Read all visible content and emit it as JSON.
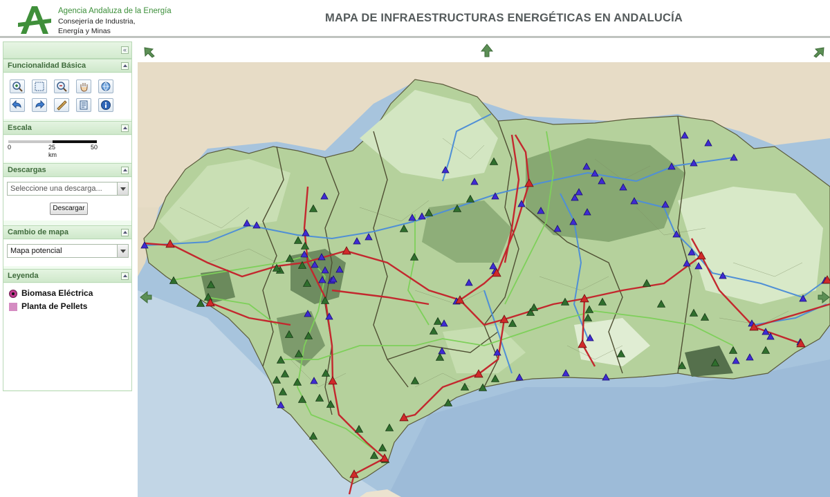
{
  "header": {
    "org_name": "Agencia Andaluza de la Energía",
    "dept_line_1": "Consejería de Industria,",
    "dept_line_2": "Energía y Minas",
    "title": "MAPA DE INFRAESTRUCTURAS ENERGÉTICAS EN ANDALUCÍA"
  },
  "sidebar": {
    "collapse_icon": "double-chevron-left-icon",
    "panels": {
      "basic": {
        "title": "Funcionalidad Básica",
        "tools": [
          "zoom-in-icon",
          "zoom-box-icon",
          "zoom-out-icon",
          "pan-hand-icon",
          "full-extent-icon",
          "back-icon",
          "forward-icon",
          "measure-icon",
          "layers-icon",
          "info-icon"
        ]
      },
      "scale": {
        "title": "Escala",
        "ticks": [
          "0",
          "25",
          "50"
        ],
        "unit": "km"
      },
      "downloads": {
        "title": "Descargas",
        "select_value": "Seleccione una descarga...",
        "button_label": "Descargar"
      },
      "map_change": {
        "title": "Cambio de mapa",
        "select_value": "Mapa potencial"
      },
      "legend": {
        "title": "Leyenda",
        "items": [
          "Biomasa Eléctrica",
          "Planta de Pellets"
        ]
      }
    }
  },
  "map": {
    "pan_icons": [
      "pan-northwest-icon",
      "pan-north-icon",
      "pan-northeast-icon",
      "pan-west-icon",
      "pan-east-icon"
    ],
    "colors": {
      "sea": "#a7c4dd",
      "land_outside": "#e7dcc6",
      "region_light": "#d7e9c7",
      "region_mid": "#a9c98f",
      "region_dark": "#6f8f62",
      "road": "#c3282e",
      "pipeline_blue": "#4f8fd6",
      "line_green": "#7ed05a",
      "marker_blue": "#3f2bd3",
      "marker_green": "#2f6e2d",
      "marker_red": "#d02a2a"
    },
    "markers": {
      "blue": [
        [
          209,
          355
        ],
        [
          469,
          284
        ],
        [
          357,
          323
        ],
        [
          371,
          326
        ],
        [
          516,
          349
        ],
        [
          533,
          343
        ],
        [
          596,
          315
        ],
        [
          610,
          313
        ],
        [
          644,
          246
        ],
        [
          686,
          263
        ],
        [
          716,
          284
        ],
        [
          716,
          392
        ],
        [
          713,
          385
        ],
        [
          678,
          409
        ],
        [
          660,
          436
        ],
        [
          642,
          468
        ],
        [
          848,
          241
        ],
        [
          860,
          251
        ],
        [
          870,
          262
        ],
        [
          901,
          271
        ],
        [
          837,
          278
        ],
        [
          831,
          286
        ],
        [
          849,
          307
        ],
        [
          829,
          321
        ],
        [
          806,
          331
        ],
        [
          754,
          295
        ],
        [
          782,
          305
        ],
        [
          917,
          291
        ],
        [
          962,
          296
        ],
        [
          978,
          339
        ],
        [
          1000,
          365
        ],
        [
          1010,
          385
        ],
        [
          993,
          381
        ],
        [
          1045,
          399
        ],
        [
          1087,
          468
        ],
        [
          1107,
          480
        ],
        [
          1114,
          487
        ],
        [
          1084,
          517
        ],
        [
          1064,
          522
        ],
        [
          1157,
          495
        ],
        [
          1161,
          432
        ],
        [
          1193,
          406
        ],
        [
          990,
          196
        ],
        [
          1024,
          207
        ],
        [
          1003,
          236
        ],
        [
          971,
          241
        ],
        [
          1061,
          228
        ],
        [
          853,
          489
        ],
        [
          818,
          540
        ],
        [
          876,
          546
        ],
        [
          751,
          546
        ],
        [
          719,
          510
        ],
        [
          639,
          508
        ],
        [
          491,
          390
        ],
        [
          479,
          406
        ],
        [
          476,
          458
        ],
        [
          445,
          454
        ],
        [
          454,
          551
        ],
        [
          406,
          586
        ],
        [
          470,
          391
        ],
        [
          465,
          372
        ],
        [
          440,
          368
        ],
        [
          442,
          337
        ],
        [
          455,
          383
        ],
        [
          482,
          404
        ],
        [
          466,
          405
        ]
      ],
      "green": [
        [
          714,
          234
        ],
        [
          661,
          302
        ],
        [
          680,
          288
        ],
        [
          620,
          308
        ],
        [
          584,
          331
        ],
        [
          599,
          372
        ],
        [
          453,
          302
        ],
        [
          419,
          374
        ],
        [
          405,
          391
        ],
        [
          437,
          384
        ],
        [
          441,
          356
        ],
        [
          431,
          348
        ],
        [
          444,
          410
        ],
        [
          470,
          435
        ],
        [
          418,
          484
        ],
        [
          446,
          486
        ],
        [
          432,
          512
        ],
        [
          406,
          521
        ],
        [
          412,
          541
        ],
        [
          400,
          550
        ],
        [
          409,
          567
        ],
        [
          430,
          553
        ],
        [
          437,
          578
        ],
        [
          462,
          576
        ],
        [
          478,
          585
        ],
        [
          471,
          540
        ],
        [
          453,
          631
        ],
        [
          519,
          621
        ],
        [
          541,
          659
        ],
        [
          553,
          648
        ],
        [
          557,
          665
        ],
        [
          563,
          619
        ],
        [
          600,
          551
        ],
        [
          636,
          517
        ],
        [
          648,
          583
        ],
        [
          672,
          560
        ],
        [
          698,
          561
        ],
        [
          716,
          548
        ],
        [
          741,
          468
        ],
        [
          767,
          452
        ],
        [
          772,
          445
        ],
        [
          817,
          437
        ],
        [
          852,
          448
        ],
        [
          871,
          437
        ],
        [
          935,
          410
        ],
        [
          956,
          440
        ],
        [
          1003,
          453
        ],
        [
          1019,
          459
        ],
        [
          1060,
          507
        ],
        [
          1107,
          507
        ],
        [
          1034,
          525
        ],
        [
          986,
          529
        ],
        [
          898,
          512
        ],
        [
          850,
          460
        ],
        [
          627,
          479
        ],
        [
          633,
          465
        ],
        [
          301,
          430
        ],
        [
          305,
          412
        ],
        [
          251,
          406
        ],
        [
          290,
          439
        ],
        [
          400,
          388
        ]
      ],
      "red": [
        [
          246,
          353
        ],
        [
          501,
          363
        ],
        [
          665,
          434
        ],
        [
          718,
          395
        ],
        [
          765,
          265
        ],
        [
          845,
          432
        ],
        [
          729,
          462
        ],
        [
          842,
          498
        ],
        [
          1014,
          370
        ],
        [
          1090,
          473
        ],
        [
          1158,
          497
        ],
        [
          1196,
          405
        ],
        [
          692,
          541
        ],
        [
          584,
          604
        ],
        [
          556,
          663
        ],
        [
          512,
          686
        ],
        [
          481,
          551
        ],
        [
          304,
          438
        ]
      ]
    }
  }
}
